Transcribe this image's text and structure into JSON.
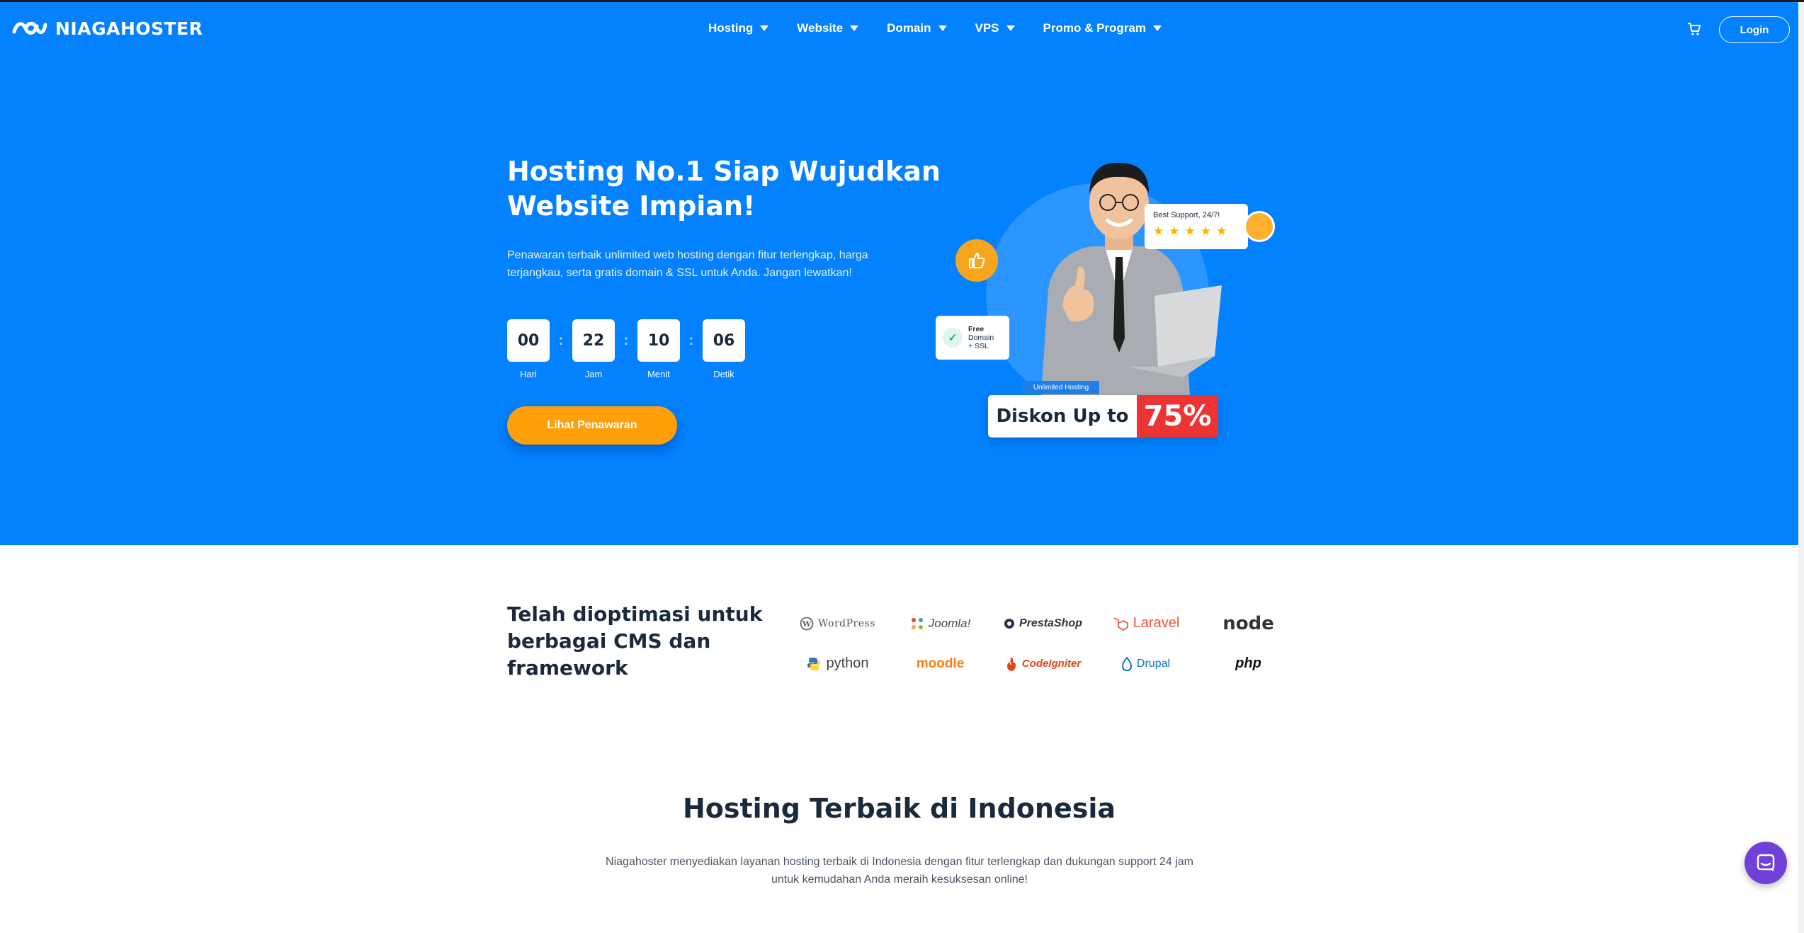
{
  "brand": {
    "name": "NIAGAHOSTER"
  },
  "nav": {
    "items": [
      {
        "label": "Hosting"
      },
      {
        "label": "Website"
      },
      {
        "label": "Domain"
      },
      {
        "label": "VPS"
      },
      {
        "label": "Promo & Program"
      }
    ],
    "login_label": "Login"
  },
  "hero": {
    "title": "Hosting No.1 Siap Wujudkan Website Impian!",
    "subtitle": "Penawaran terbaik unlimited web hosting dengan fitur terlengkap, harga terjangkau, serta gratis domain & SSL untuk Anda. Jangan lewatkan!",
    "countdown": [
      {
        "value": "00",
        "label": "Hari"
      },
      {
        "value": "22",
        "label": "Jam"
      },
      {
        "value": "10",
        "label": "Menit"
      },
      {
        "value": "06",
        "label": "Detik"
      }
    ],
    "cta_label": "Lihat Penawaran",
    "illustration": {
      "support_text": "Best Support, 24/7!",
      "star_count": 5,
      "free_title": "Free",
      "free_line2": "Domain",
      "free_line3": "+ SSL",
      "tag": "Unlimited Hosting",
      "diskon_label": "Diskon Up to",
      "diskon_value": "75%"
    }
  },
  "cms": {
    "title": "Telah dioptimasi untuk berbagai CMS dan framework",
    "logos": [
      "WordPress",
      "Joomla!",
      "PrestaShop",
      "Laravel",
      "node",
      "python",
      "moodle",
      "CodeIgniter",
      "Drupal",
      "php"
    ]
  },
  "best": {
    "title": "Hosting Terbaik di Indonesia",
    "subtitle": "Niagahoster menyediakan layanan hosting terbaik di Indonesia dengan fitur terlengkap dan dukungan support 24 jam untuk kemudahan Anda meraih kesuksesan online!"
  },
  "colors": {
    "primary": "#0381fe",
    "cta": "#ff9f0a",
    "discount": "#ec3434",
    "chat": "#6f41d8"
  }
}
